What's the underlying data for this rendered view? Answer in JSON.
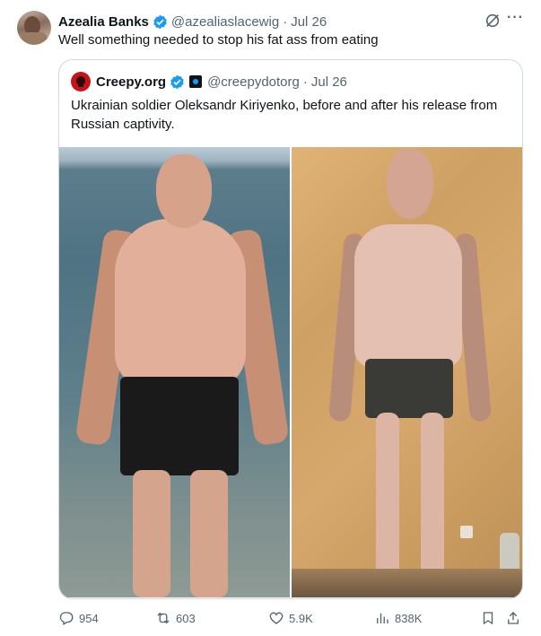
{
  "tweet": {
    "author_name": "Azealia Banks",
    "author_handle": "@azealiaslacewig",
    "separator": "·",
    "date": "Jul 26",
    "more_label": "···",
    "text": "Well something needed to stop his fat ass from eating"
  },
  "quote": {
    "author_name": "Creepy.org",
    "author_handle": "@creepydotorg",
    "separator": "·",
    "date": "Jul 26",
    "text": "Ukrainian soldier Oleksandr Kiriyenko, before and after his release from Russian captivity."
  },
  "actions": {
    "replies": "954",
    "reposts": "603",
    "likes": "5.9K",
    "views": "838K"
  },
  "colors": {
    "verified": "#1d9bf0",
    "secondary_text": "#536471",
    "border": "#cfd9de",
    "creepy_avatar": "#c7121a"
  },
  "icons": [
    "verified-icon",
    "grok-icon",
    "more-icon",
    "affiliate-icon",
    "reply-icon",
    "repost-icon",
    "like-icon",
    "views-icon",
    "bookmark-icon",
    "share-icon"
  ]
}
